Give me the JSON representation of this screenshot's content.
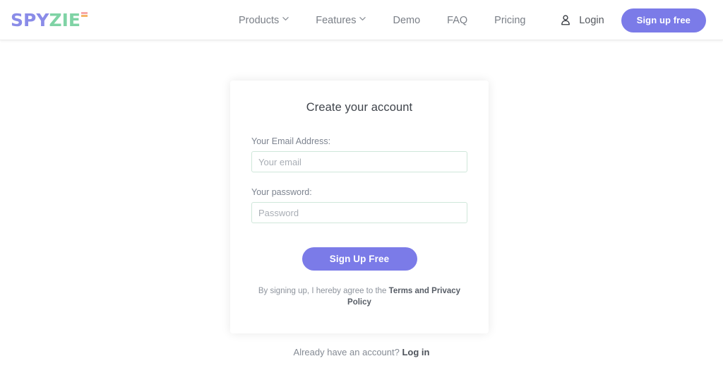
{
  "header": {
    "logo": {
      "part1": "SPY",
      "part2": "ZIE",
      "mark_icon": "trademark-bars-icon",
      "color1": "#8a8ce8",
      "color2": "#7fd3a5"
    },
    "nav": [
      {
        "label": "Products",
        "has_dropdown": true,
        "icon": "chevron-down-icon"
      },
      {
        "label": "Features",
        "has_dropdown": true,
        "icon": "chevron-down-icon"
      },
      {
        "label": "Demo",
        "has_dropdown": false
      },
      {
        "label": "FAQ",
        "has_dropdown": false
      },
      {
        "label": "Pricing",
        "has_dropdown": false
      }
    ],
    "account_icon": "user-icon",
    "login_label": "Login",
    "signup_label": "Sign up free",
    "accent_color": "#7b7be8"
  },
  "card": {
    "title": "Create your account",
    "fields": [
      {
        "label": "Your Email Address:",
        "placeholder": "Your email",
        "value": "",
        "type": "email"
      },
      {
        "label": "Your password:",
        "placeholder": "Password",
        "value": "",
        "type": "password"
      }
    ],
    "submit_label": "Sign Up Free",
    "terms_prefix": "By signing up, I hereby agree to the ",
    "terms_link": "Terms and Privacy Policy",
    "border_color": "#cfe7da"
  },
  "footer": {
    "already_prefix": "Already have an account? ",
    "login_link": "Log in"
  }
}
